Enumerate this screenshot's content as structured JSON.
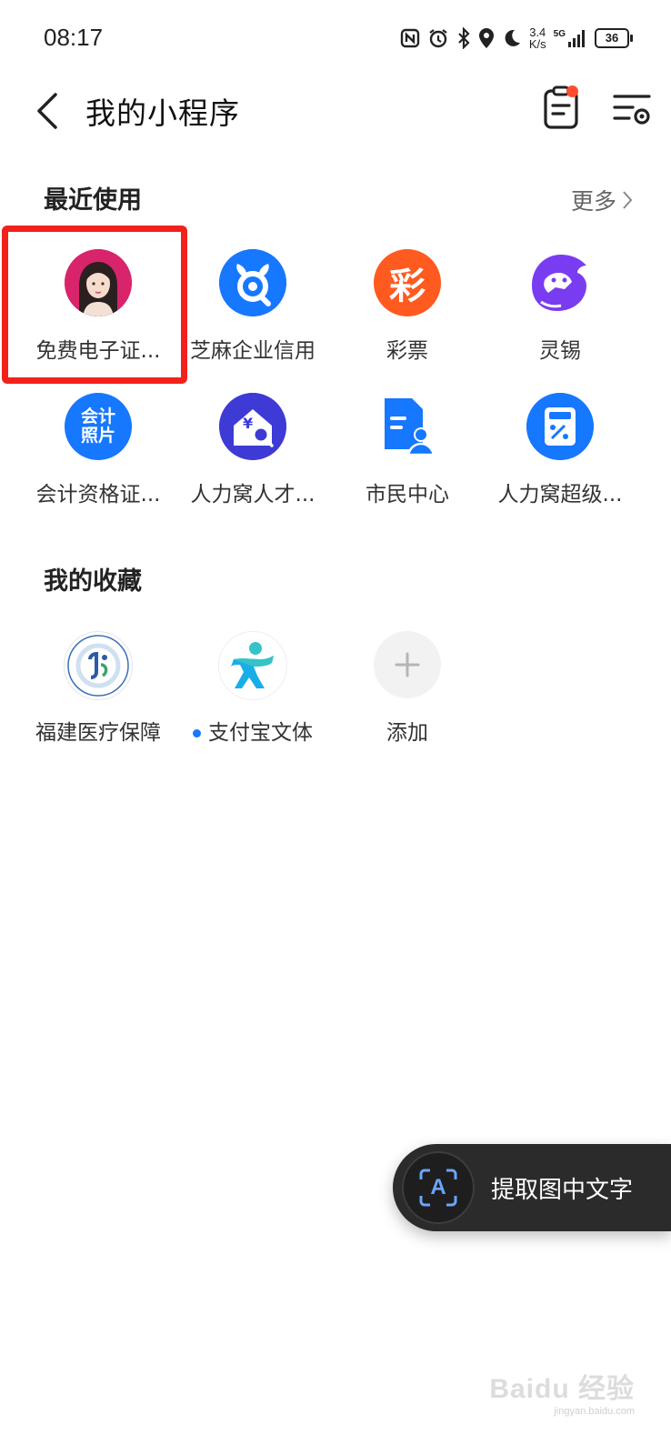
{
  "status_bar": {
    "time": "08:17",
    "net_speed_value": "3.4",
    "net_speed_unit": "K/s",
    "signal_label": "5G",
    "battery": "36",
    "icons": [
      "nfc-icon",
      "alarm-icon",
      "bluetooth-icon",
      "location-icon",
      "moon-icon",
      "signal-icon",
      "battery-icon"
    ]
  },
  "header": {
    "title": "我的小程序",
    "back_icon": "chevron-left-icon",
    "list_icon": "clipboard-list-icon",
    "settings_icon": "list-settings-icon"
  },
  "recent": {
    "title": "最近使用",
    "more_label": "更多",
    "items": [
      {
        "label": "免费电子证...",
        "icon": "avatar-woman-icon"
      },
      {
        "label": "芝麻企业信用",
        "icon": "zhima-credit-icon"
      },
      {
        "label": "彩票",
        "icon": "lottery-icon",
        "glyph": "彩"
      },
      {
        "label": "灵锡",
        "icon": "lingxi-icon"
      },
      {
        "label": "会计资格证...",
        "icon": "accounting-photo-icon",
        "glyph_top": "会计",
        "glyph_bottom": "照片"
      },
      {
        "label": "人力窝人才...",
        "icon": "house-search-icon",
        "glyph": "¥"
      },
      {
        "label": "市民中心",
        "icon": "citizen-center-icon"
      },
      {
        "label": "人力窝超级...",
        "icon": "calculator-icon"
      }
    ]
  },
  "favorites": {
    "title": "我的收藏",
    "items": [
      {
        "label": "福建医疗保障",
        "icon": "fujian-medical-icon"
      },
      {
        "label": "支付宝文体",
        "icon": "running-man-icon",
        "has_dot": true
      },
      {
        "label": "添加",
        "icon": "plus-icon"
      }
    ]
  },
  "ocr_button": {
    "label": "提取图中文字",
    "icon": "text-scan-icon",
    "icon_letter": "A"
  },
  "watermark": {
    "text": "Baidu 经验",
    "url": "jingyan.baidu.com"
  },
  "colors": {
    "highlight": "#f2221b",
    "blue": "#1677ff",
    "lottery_orange": "#ff5a1f",
    "purple": "#7a3cf0"
  }
}
